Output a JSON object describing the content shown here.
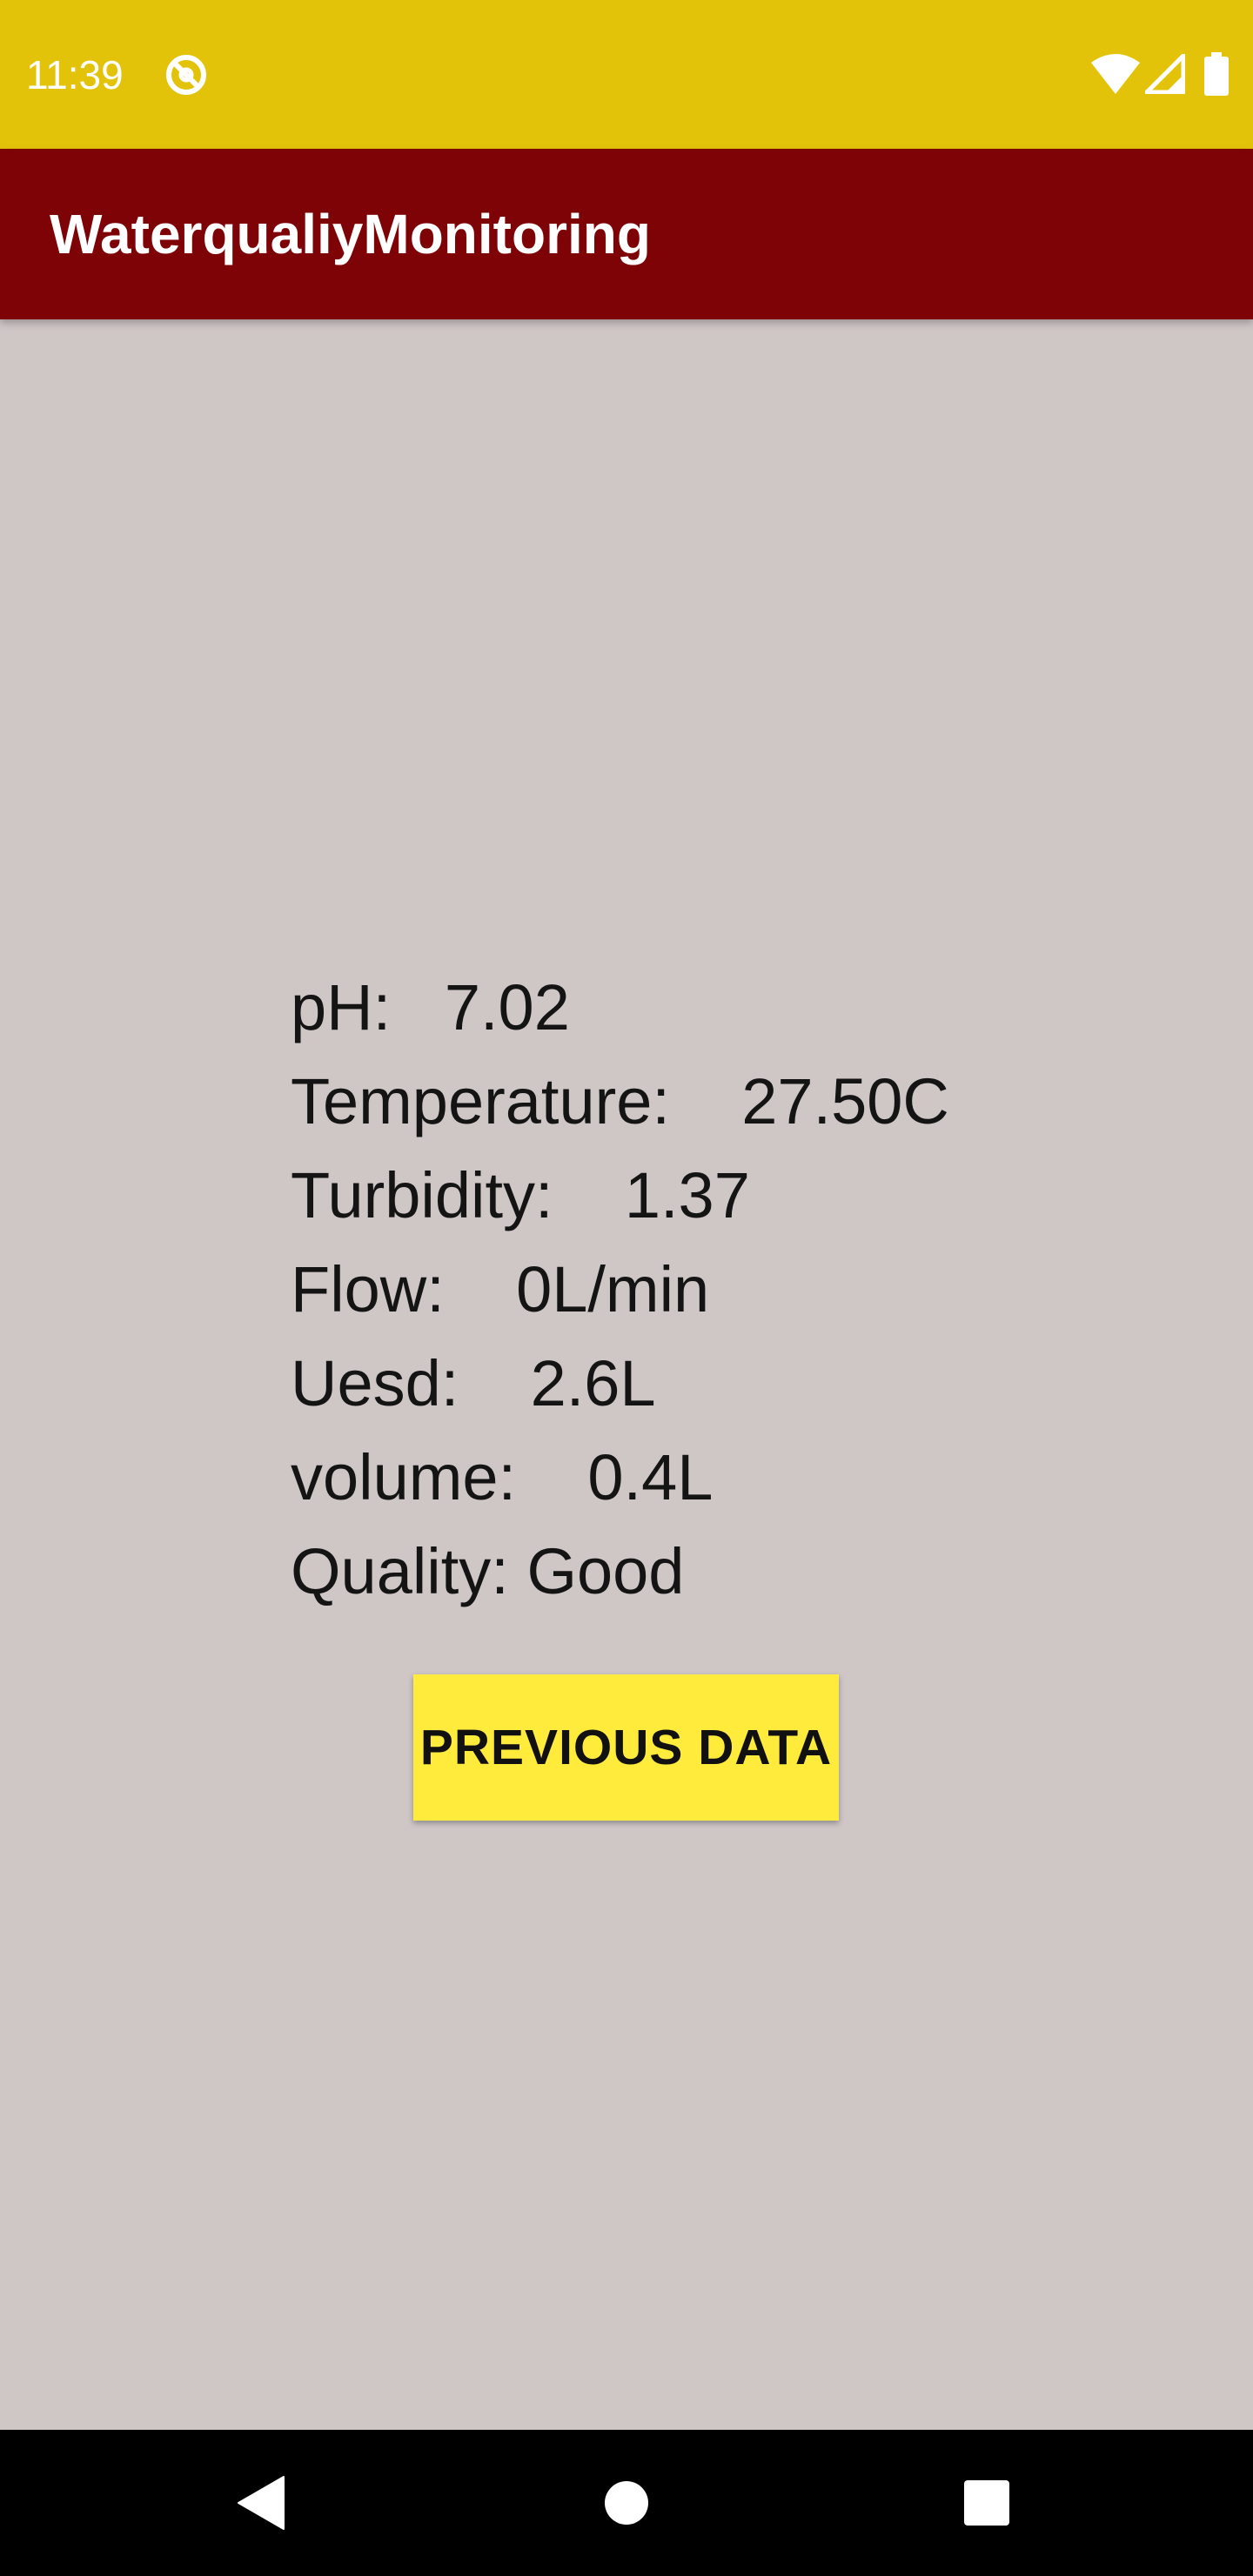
{
  "status_bar": {
    "time": "11:39",
    "icons": [
      "sync-icon",
      "wifi-icon",
      "signal-icon",
      "battery-icon"
    ]
  },
  "app_bar": {
    "title": "WaterqualiyMonitoring"
  },
  "readings": [
    {
      "label": "pH:",
      "sep": "   ",
      "value": "7.02"
    },
    {
      "label": "Temperature:",
      "sep": "    ",
      "value": "27.50C"
    },
    {
      "label": "Turbidity:",
      "sep": "    ",
      "value": "1.37"
    },
    {
      "label": "Flow:",
      "sep": "    ",
      "value": "0L/min"
    },
    {
      "label": "Uesd:",
      "sep": "    ",
      "value": "2.6L"
    },
    {
      "label": "volume:",
      "sep": "    ",
      "value": "0.4L"
    },
    {
      "label": "Quality:",
      "sep": " ",
      "value": "Good"
    }
  ],
  "buttons": {
    "previous_data": "PREVIOUS DATA"
  },
  "nav_bar": {
    "icons": [
      "back-icon",
      "home-icon",
      "recents-icon"
    ]
  },
  "colors": {
    "status_bar": "#e3c309",
    "app_bar": "#7d0306",
    "background": "#cfc6c6",
    "button": "#ffeb3b"
  }
}
